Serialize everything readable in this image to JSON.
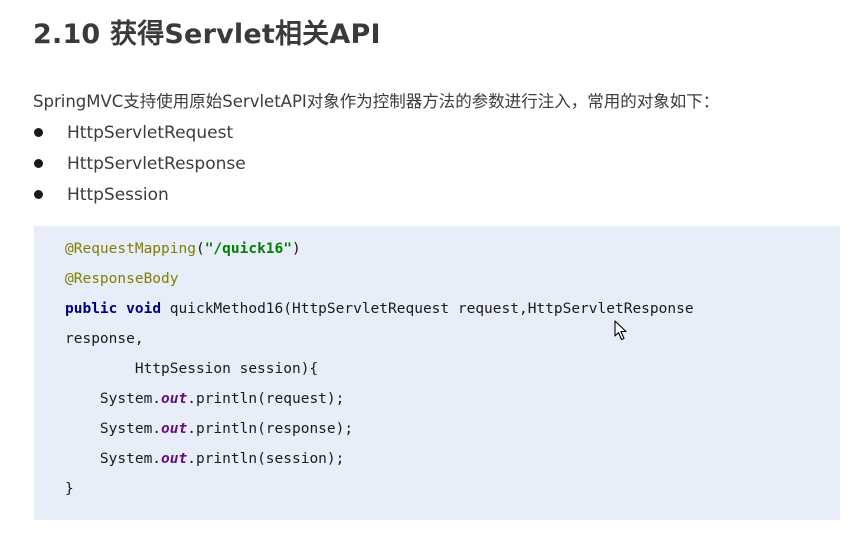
{
  "title": "2.10 获得Servlet相关API",
  "intro": "SpringMVC支持使用原始ServletAPI对象作为控制器方法的参数进行注入，常用的对象如下：",
  "bullets": [
    "HttpServletRequest",
    "HttpServletResponse",
    "HttpSession"
  ],
  "code": {
    "line1": {
      "annotation": "@RequestMapping",
      "paren_open": "(",
      "path": "\"/quick16\"",
      "paren_close": ")"
    },
    "line2": {
      "annotation": "@ResponseBody"
    },
    "line3": {
      "kw_public": "public",
      "kw_void": "void",
      "text": " quickMethod16(HttpServletRequest request,HttpServletResponse"
    },
    "line4": {
      "text": "response,"
    },
    "line5": {
      "text": "        HttpSession session){"
    },
    "line6": {
      "prefix": "    System.",
      "field": "out",
      "suffix": ".println(request);"
    },
    "line7": {
      "prefix": "    System.",
      "field": "out",
      "suffix": ".println(response);"
    },
    "line8": {
      "prefix": "    System.",
      "field": "out",
      "suffix": ".println(session);"
    },
    "line9": {
      "text": "}"
    }
  },
  "icons": {
    "cursor": "mouse-pointer-icon"
  },
  "colors": {
    "code_background": "#e7eef9",
    "annotation": "#808000",
    "string": "#008000",
    "keyword": "#000080",
    "static_field": "#660e7a"
  }
}
